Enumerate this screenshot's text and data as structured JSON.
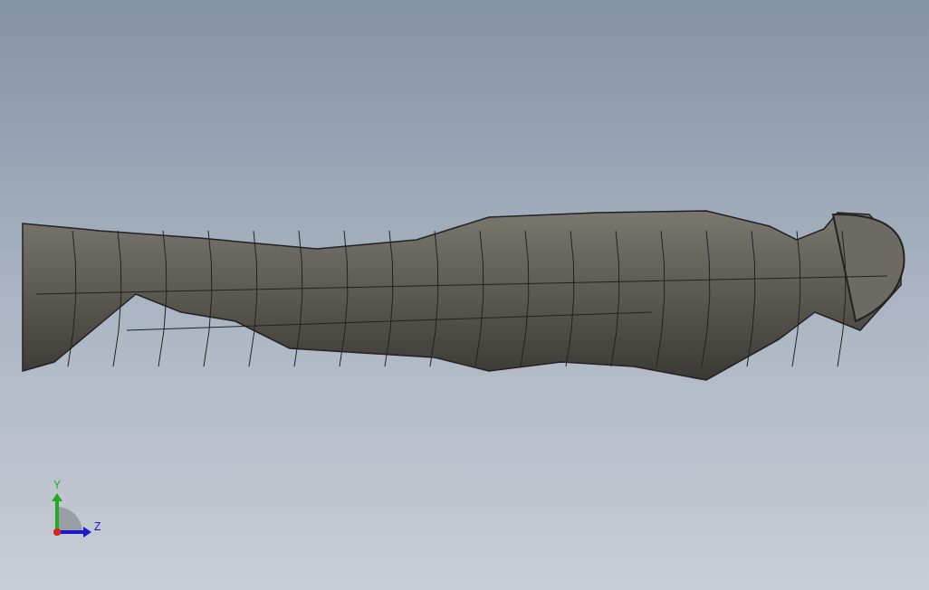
{
  "viewport": {
    "model": {
      "kind": "figure"
    },
    "triad": {
      "axes": [
        {
          "label": "Y",
          "color": "#22aa22"
        },
        {
          "label": "Z",
          "color": "#1a1acc"
        }
      ]
    }
  }
}
